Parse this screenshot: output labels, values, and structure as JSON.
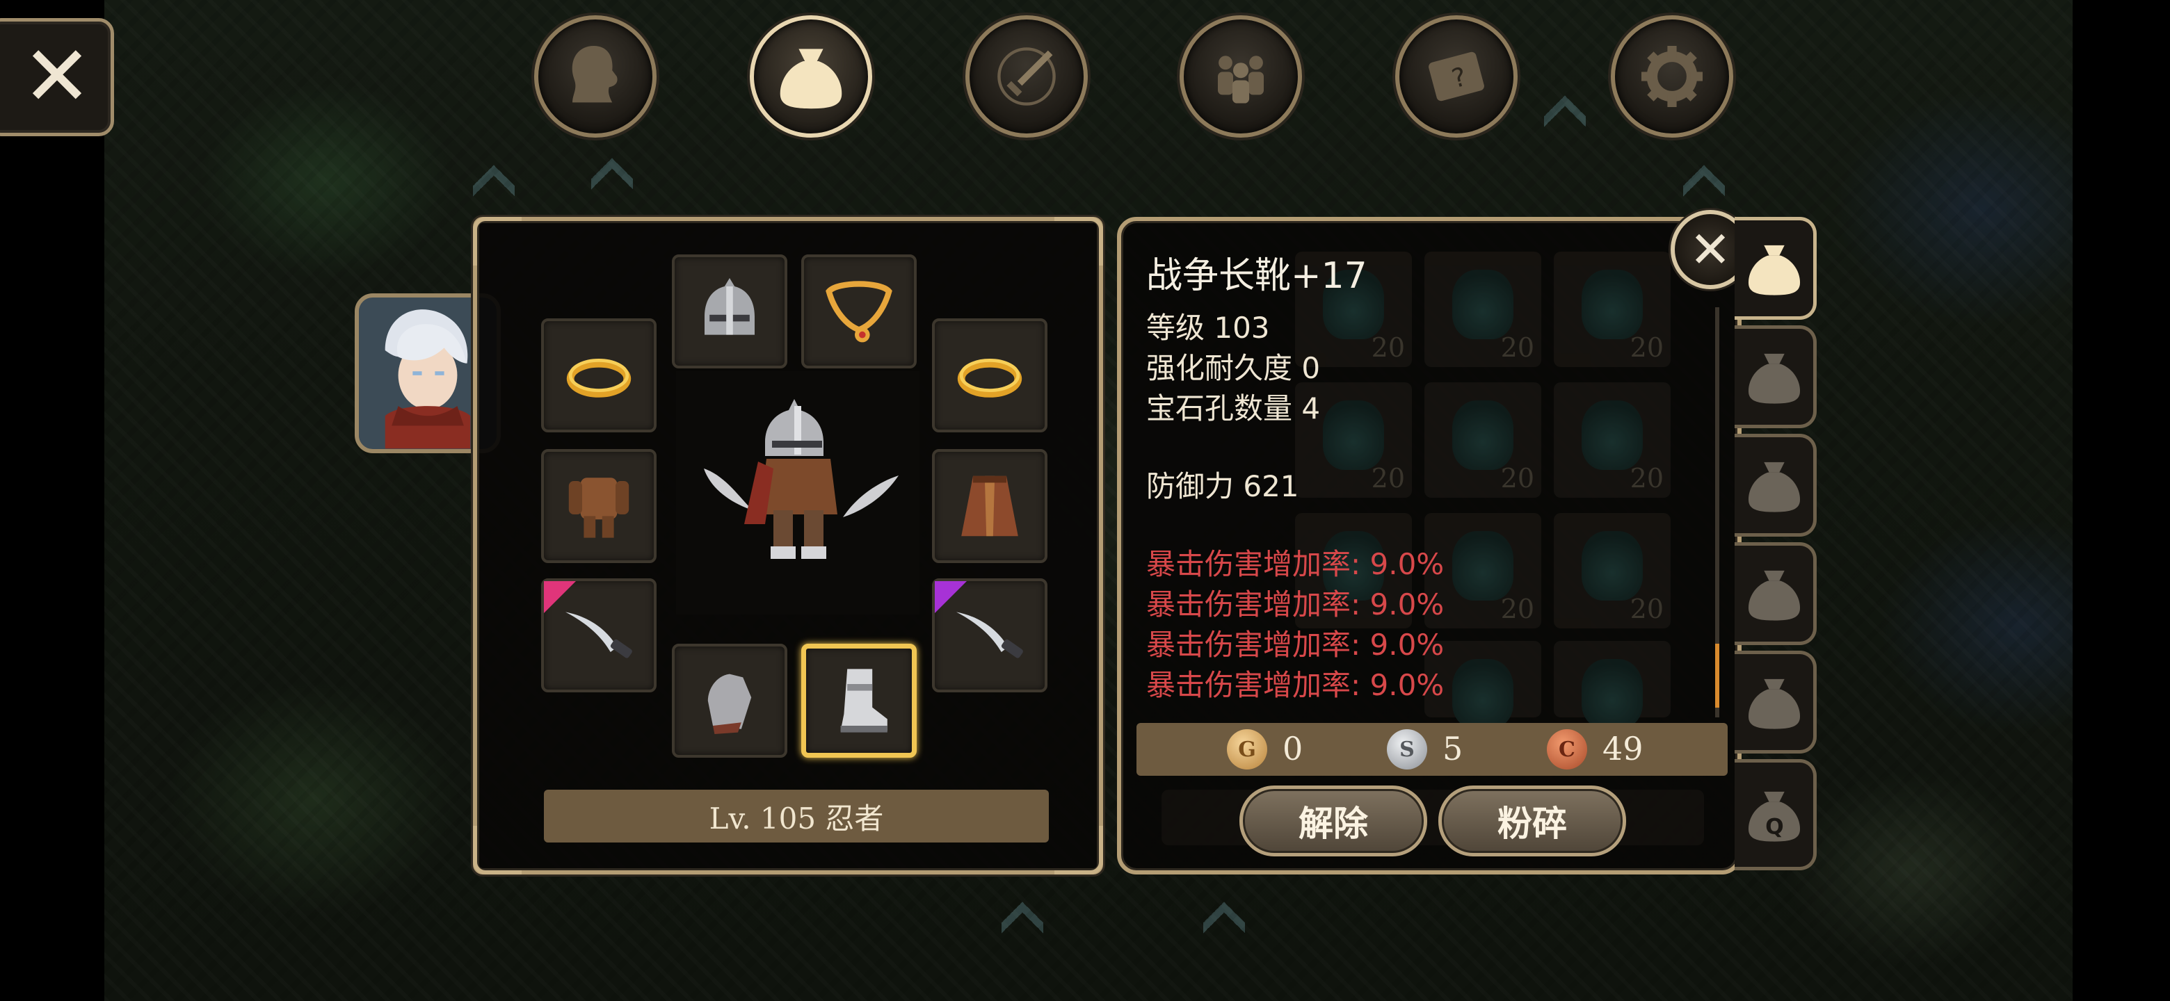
{
  "top_nav": {
    "tabs": [
      {
        "icon": "head-silhouette-icon",
        "active": false
      },
      {
        "icon": "bag-icon",
        "active": true
      },
      {
        "icon": "sword-icon",
        "active": false
      },
      {
        "icon": "party-icon",
        "active": false
      },
      {
        "icon": "quest-scroll-icon",
        "active": false
      },
      {
        "icon": "gear-icon",
        "active": false
      }
    ]
  },
  "equipment": {
    "level_label": "Lv. 105 忍者",
    "selected_slot": "boots",
    "slots": [
      {
        "slot": "helmet",
        "icon": "helmet-icon"
      },
      {
        "slot": "necklace",
        "icon": "necklace-icon"
      },
      {
        "slot": "ring-left",
        "icon": "ring-icon"
      },
      {
        "slot": "ring-right",
        "icon": "ring-icon"
      },
      {
        "slot": "armor",
        "icon": "armor-icon"
      },
      {
        "slot": "cloak",
        "icon": "cloak-icon"
      },
      {
        "slot": "weapon-left",
        "icon": "blade-icon",
        "rarity_color": "#e0357a"
      },
      {
        "slot": "weapon-right",
        "icon": "blade-icon",
        "rarity_color": "#a732d6"
      },
      {
        "slot": "gloves",
        "icon": "gauntlet-icon"
      },
      {
        "slot": "boots",
        "icon": "boot-icon"
      }
    ]
  },
  "item_detail": {
    "name": "战争长靴+17",
    "level": "等级 103",
    "durability": "强化耐久度 0",
    "sockets": "宝石孔数量 4",
    "defense": "防御力 621",
    "bonuses": [
      "暴击伤害增加率: 9.0%",
      "暴击伤害增加率: 9.0%",
      "暴击伤害增加率: 9.0%",
      "暴击伤害增加率: 9.0%"
    ],
    "bonus_color": "#d8484a",
    "ghost_slot_count": "20",
    "currency": {
      "gold": "0",
      "silver": "5",
      "copper": "49",
      "gold_symbol": "G",
      "silver_symbol": "S",
      "copper_symbol": "C"
    },
    "buttons": {
      "unequip": "解除",
      "smash": "粉碎"
    }
  },
  "bag_tabs": [
    {
      "icon": "bag-icon",
      "active": true
    },
    {
      "icon": "bag-icon",
      "active": false
    },
    {
      "icon": "bag-icon",
      "active": false
    },
    {
      "icon": "bag-icon",
      "active": false
    },
    {
      "icon": "bag-icon",
      "active": false
    },
    {
      "icon": "bag-q-icon",
      "active": false
    }
  ],
  "colors": {
    "panel_border": "#b49d74",
    "selected_slot": "#f1c653",
    "bar_brown": "#6e5b40"
  }
}
